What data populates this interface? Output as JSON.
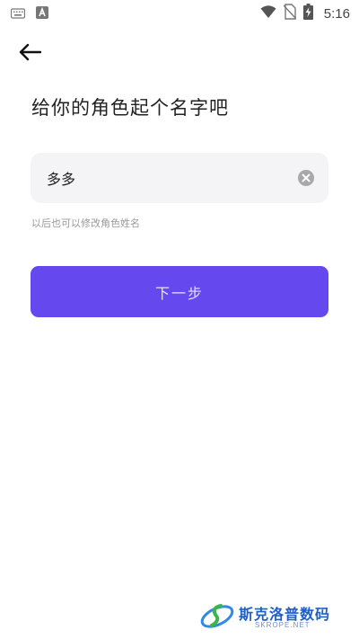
{
  "status_bar": {
    "time": "5:16",
    "left_icons": [
      "keyboard-icon",
      "a-notification-icon"
    ],
    "right_icons": [
      "wifi-icon",
      "no-sim-icon",
      "battery-charging-icon"
    ]
  },
  "header": {
    "back_icon": "arrow-left-icon"
  },
  "main": {
    "title": "给你的角色起个名字吧",
    "name_input": {
      "value": "多多",
      "clear_icon": "clear-icon"
    },
    "hint": "以后也可以修改角色姓名",
    "next_button_label": "下一步"
  },
  "colors": {
    "accent": "#6648ef",
    "button_text": "#e7e1ff",
    "input_bg": "#f4f4f6",
    "hint_text": "#9a9a9a"
  },
  "watermark": {
    "text": "斯克洛普数码",
    "subtext": "SKROPE.NET"
  }
}
